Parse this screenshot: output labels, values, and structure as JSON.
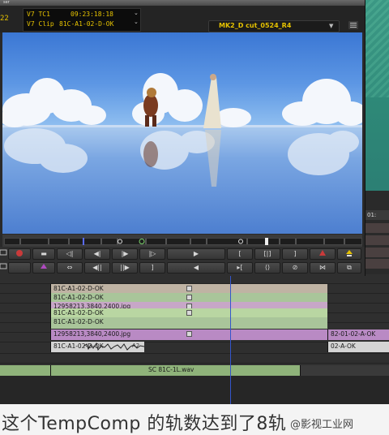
{
  "window": {
    "title": "ser",
    "tc_number": "22",
    "track_rows": [
      {
        "track": "V7",
        "label": "TC1",
        "value": "09:23:18:18"
      },
      {
        "track": "V7",
        "label": "Clip",
        "value": "81C-A1-02-D-OK"
      }
    ],
    "sequence_name": "MK2_D cut_0524_R4"
  },
  "transport": {
    "row1": [
      "mark-in",
      "mark-clip",
      "go-prev-edit",
      "step-back",
      "step-forward",
      "go-next-edit",
      "play",
      "mark-in",
      "mark-clip",
      "mark-out",
      "lift",
      "extract"
    ],
    "row2": [
      "mode-toggle",
      "link",
      "step-back-10",
      "step-forward-10",
      "mark-out",
      "jog-back",
      "splice",
      "overwrite",
      "no-entry",
      "trim",
      "match-frame"
    ]
  },
  "timeline": {
    "ruler_label": "01:",
    "clips": [
      {
        "row": 0,
        "name": "81C-A1-02-D-OK",
        "color": "#bfb3a3"
      },
      {
        "row": 1,
        "name": "81C-A1-02-D-OK",
        "color": "#a9c59a"
      },
      {
        "row": 2,
        "name": "12958213,3840,2400.jpg",
        "color": "#c7a7c7"
      },
      {
        "row": 3,
        "name": "81C-A1-02-D-OK",
        "color": "#b9d6a2"
      },
      {
        "row": 4,
        "name": "81C-A1-02-D-OK",
        "color": "#a9c59a"
      },
      {
        "row": 5,
        "name": "12958213,3840,2400.jpg",
        "color": "#b98ac4"
      },
      {
        "row": 6,
        "name": "81C-A1-02-D-OK",
        "color": "#d4d4d4"
      },
      {
        "row": 8,
        "name": "SC 81C-1L.wav",
        "color": "#8fb37a"
      }
    ],
    "right_clips": [
      "82-01-02-A-OK",
      "02-A-OK"
    ],
    "audio_badge": "A2"
  },
  "caption": {
    "text": "这个TempComp 的轨数达到了8轨",
    "watermark": "@影视工业网"
  },
  "colors": {
    "timecode": "#e6c200",
    "playhead": "#3355cc"
  }
}
